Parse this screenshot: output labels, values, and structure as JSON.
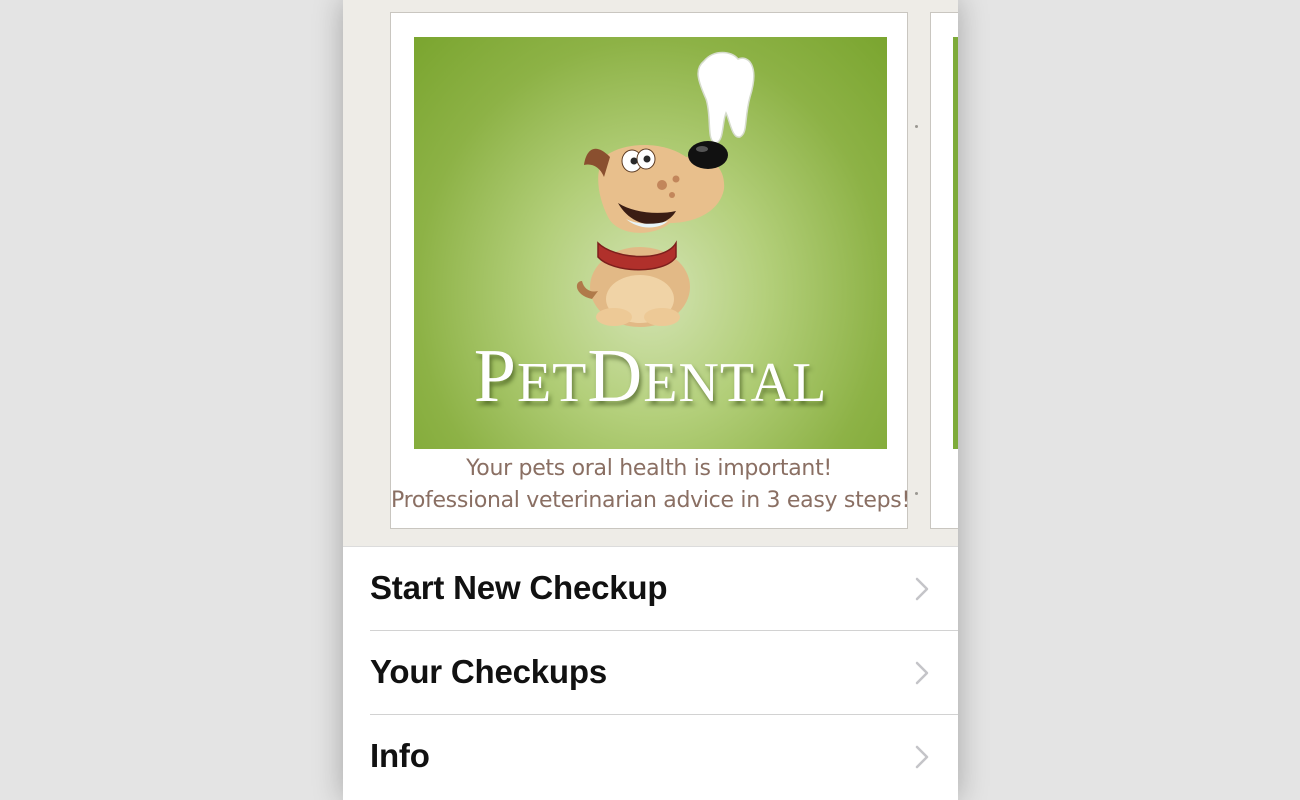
{
  "brand": {
    "name_initial_1": "P",
    "name_rest_1": "ET",
    "name_initial_2": "D",
    "name_rest_2": "ENTAL",
    "background_color": "#7eab3a"
  },
  "promo": {
    "tagline_line1": "Your pets oral health is important!",
    "tagline_line2": "Professional veterinarian advice in 3 easy steps!",
    "tagline_color": "#8a6f63"
  },
  "menu": {
    "items": [
      {
        "label": "Start New Checkup",
        "icon": "chevron-right-icon"
      },
      {
        "label": "Your Checkups",
        "icon": "chevron-right-icon"
      },
      {
        "label": "Info",
        "icon": "chevron-right-icon"
      }
    ]
  }
}
